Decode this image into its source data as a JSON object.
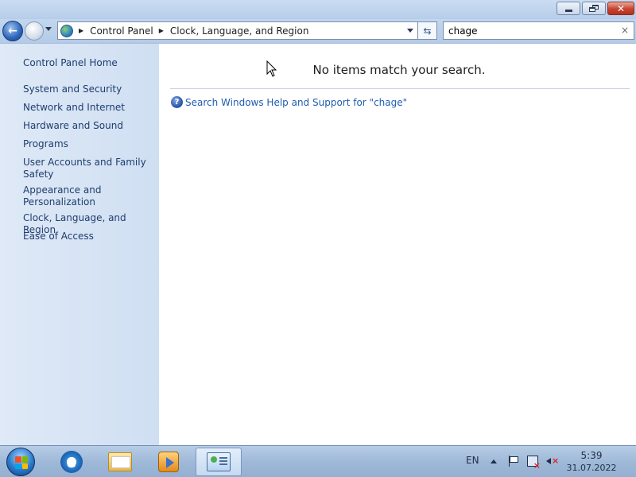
{
  "window": {
    "minimize_icon": "minimize-icon",
    "maximize_icon": "restore-icon",
    "close_glyph": "✕"
  },
  "navigation": {
    "back_glyph": "←",
    "breadcrumbs": [
      "Control Panel",
      "Clock, Language, and Region"
    ],
    "breadcrumb_separator": "▶",
    "refresh_glyph": "⇆"
  },
  "search": {
    "value": "chage",
    "clear_glyph": "×"
  },
  "left_pane": {
    "home": "Control Panel Home",
    "items": [
      "System and Security",
      "Network and Internet",
      "Hardware and Sound",
      "Programs",
      "User Accounts and Family Safety",
      "Appearance and Personalization",
      "Clock, Language, and Region",
      "Ease of Access"
    ]
  },
  "content": {
    "message": "No items match your search.",
    "help_link": "Search Windows Help and Support for \"chage\"",
    "help_icon_glyph": "?"
  },
  "taskbar": {
    "items": [
      "start-orb",
      "internet-explorer-icon",
      "windows-explorer-icon",
      "media-player-icon",
      "control-panel-icon"
    ],
    "active_item": "control-panel-icon",
    "language": "EN",
    "time": "5:39",
    "date": "31.07.2022"
  },
  "colors": {
    "link": "#1f5cb0",
    "left_pane_link": "#1e3d6e",
    "left_pane_bg": "#dfe9f7",
    "frame": "#bcd3ec",
    "close_button": "#c8432e"
  }
}
